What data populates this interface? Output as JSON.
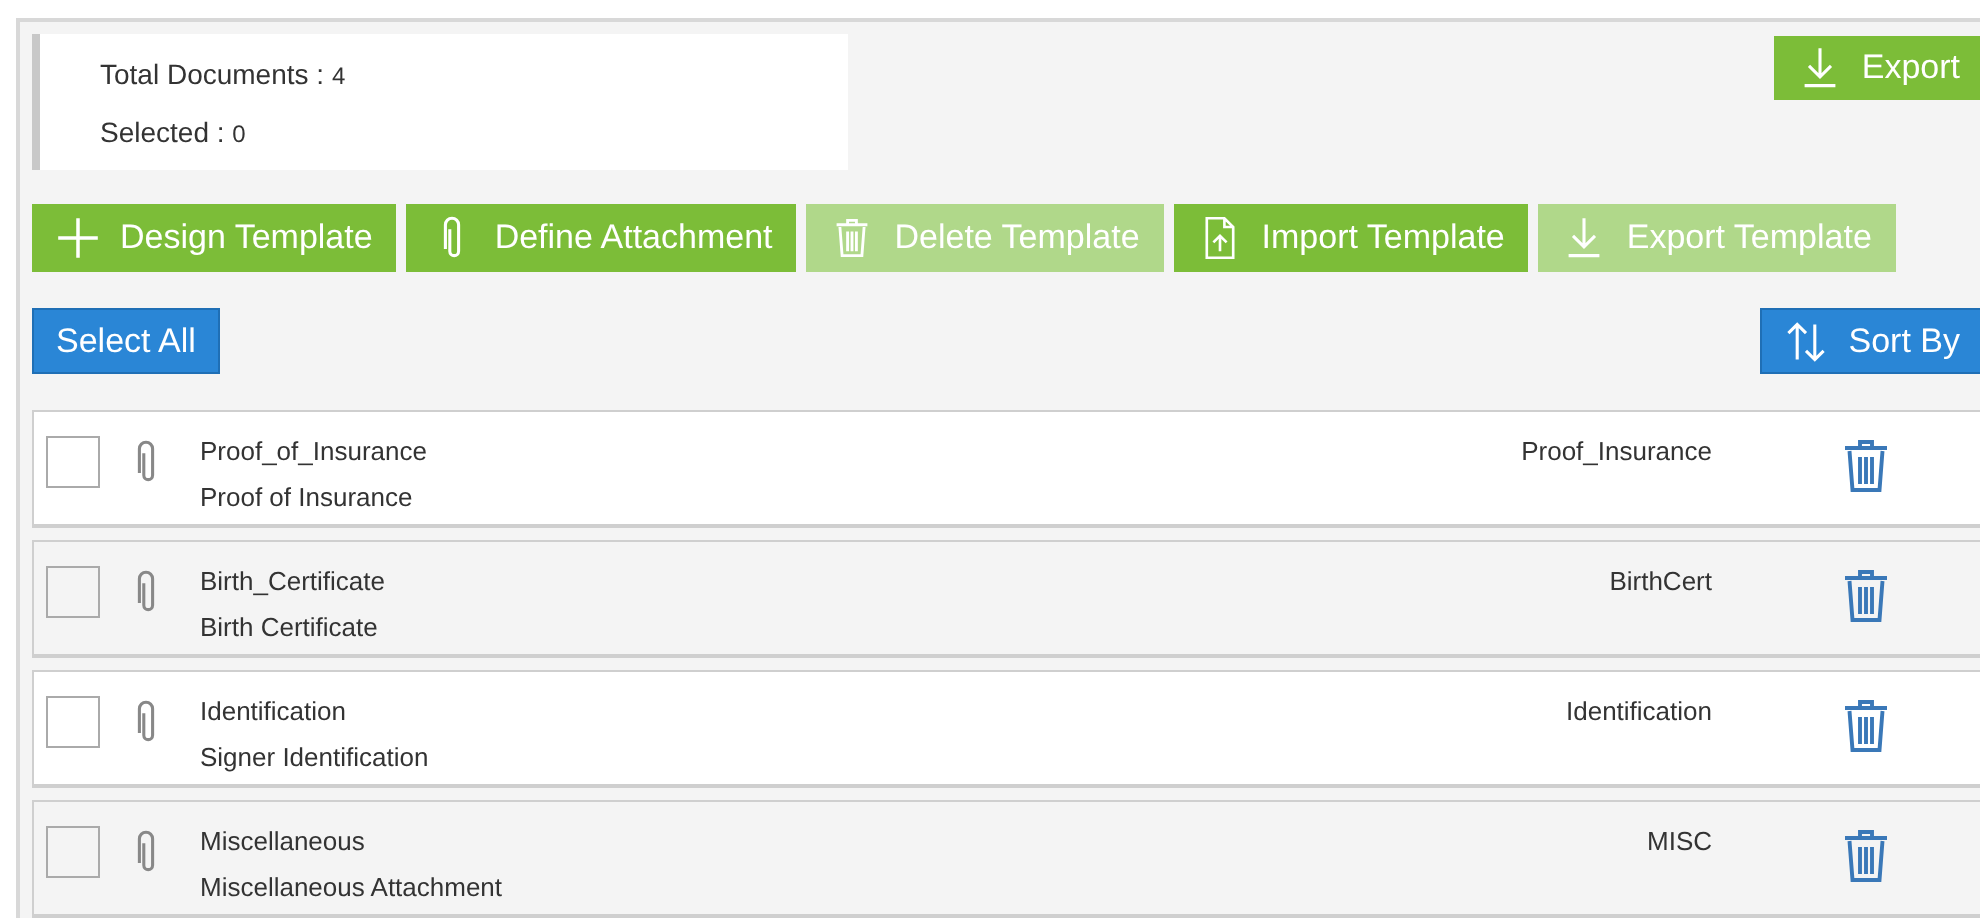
{
  "summary": {
    "total_label": "Total Documents :",
    "total_value": "4",
    "selected_label": "Selected :",
    "selected_value": "0"
  },
  "export_button": {
    "label": "Export"
  },
  "toolbar": [
    {
      "label": "Design Template",
      "kind": "design",
      "disabled": false
    },
    {
      "label": "Define Attachment",
      "kind": "define",
      "disabled": false
    },
    {
      "label": "Delete Template",
      "kind": "delete",
      "disabled": true
    },
    {
      "label": "Import Template",
      "kind": "import",
      "disabled": false
    },
    {
      "label": "Export Template",
      "kind": "export",
      "disabled": true
    }
  ],
  "select_all": "Select All",
  "sort_button": {
    "label": "Sort By"
  },
  "documents": [
    {
      "name": "Proof_of_Insurance",
      "description": "Proof of Insurance",
      "code": "Proof_Insurance",
      "checked": false
    },
    {
      "name": "Birth_Certificate",
      "description": "Birth Certificate",
      "code": "BirthCert",
      "checked": false
    },
    {
      "name": "Identification",
      "description": "Signer Identification",
      "code": "Identification",
      "checked": false
    },
    {
      "name": "Miscellaneous",
      "description": "Miscellaneous Attachment",
      "code": "MISC",
      "checked": false
    }
  ]
}
